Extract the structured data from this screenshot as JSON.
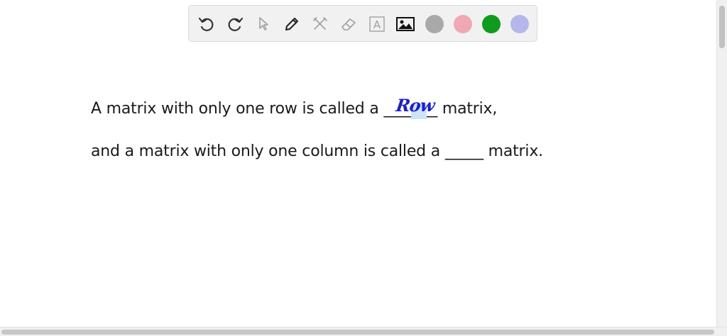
{
  "toolbar": {
    "tools": [
      {
        "name": "undo-icon"
      },
      {
        "name": "redo-icon"
      },
      {
        "name": "pointer-icon"
      },
      {
        "name": "pen-icon"
      },
      {
        "name": "tools-icon"
      },
      {
        "name": "eraser-icon"
      },
      {
        "name": "text-icon",
        "glyph": "A"
      },
      {
        "name": "image-icon"
      }
    ],
    "colors": [
      "#a9a9a9",
      "#f0a8b4",
      "#0e9b1e",
      "#b6b6ea"
    ]
  },
  "content": {
    "line1_before": "A matrix with only one row is called a ",
    "line1_blank": "_______",
    "line1_after": " matrix,",
    "handwritten": "Row",
    "line2_before": "and a matrix with only one column is called a ",
    "line2_blank": "_____",
    "line2_after": " matrix."
  }
}
